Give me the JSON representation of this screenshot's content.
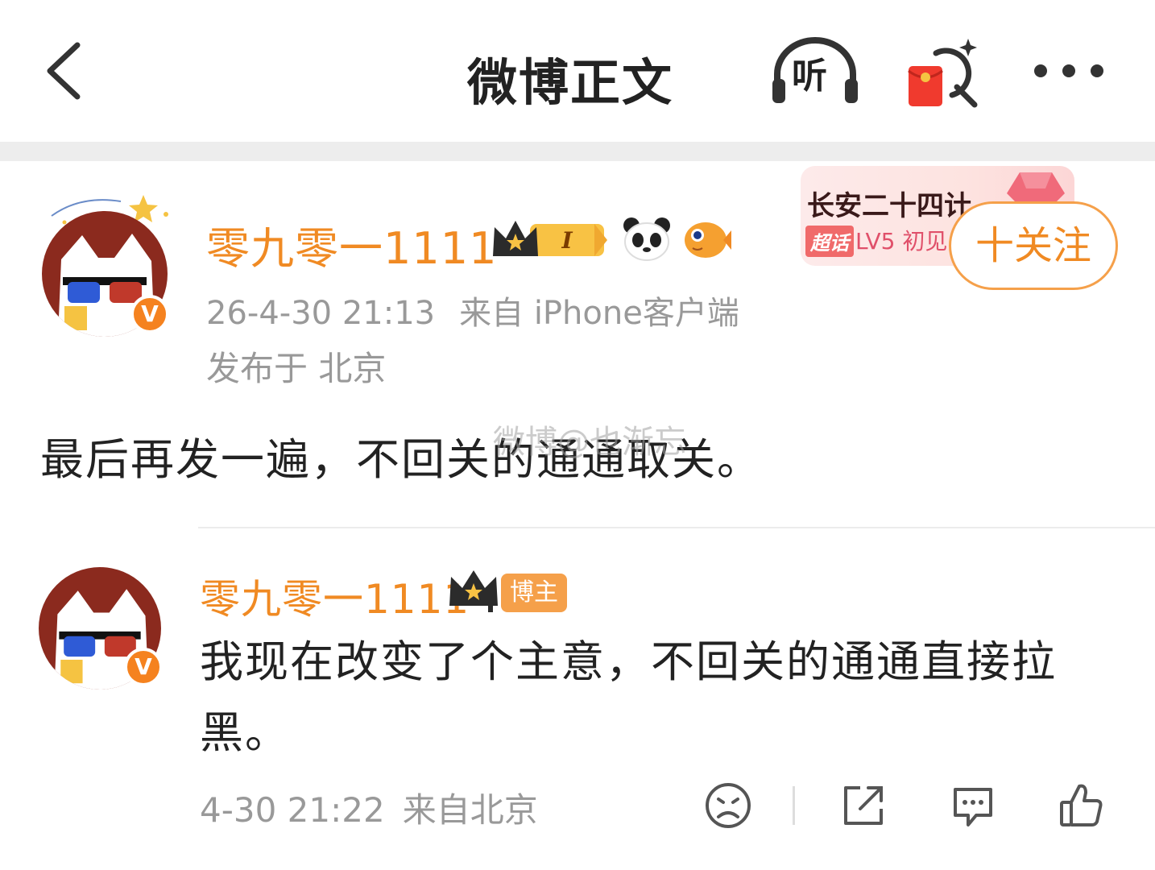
{
  "header": {
    "back_icon": "chevron-left-icon",
    "title": "微博正文",
    "listen_label": "听",
    "redpack_icon": "red-envelope-search-icon",
    "more_icon": "more-dots-icon"
  },
  "post": {
    "author": "零九零一1111",
    "member_level": "I",
    "timestamp": "26-4-30 21:13",
    "source": "来自 iPhone客户端",
    "location": "发布于 北京",
    "text": "最后再发一遍，不回关的通通取关。",
    "follow_label": "十关注"
  },
  "supertopic": {
    "name": "长安二十四计",
    "tag": "超话",
    "level": "LV5 初见"
  },
  "watermark": "微博@也渐忘",
  "reply": {
    "author": "零九零一1111",
    "author_badge": "博主",
    "text": "我现在改变了个主意，不回关的通通直接拉黑。",
    "timestamp": "4-30 21:22",
    "source": "来自北京"
  },
  "colors": {
    "accent": "#f08a23",
    "meta": "#999999",
    "divider": "#ededed"
  }
}
